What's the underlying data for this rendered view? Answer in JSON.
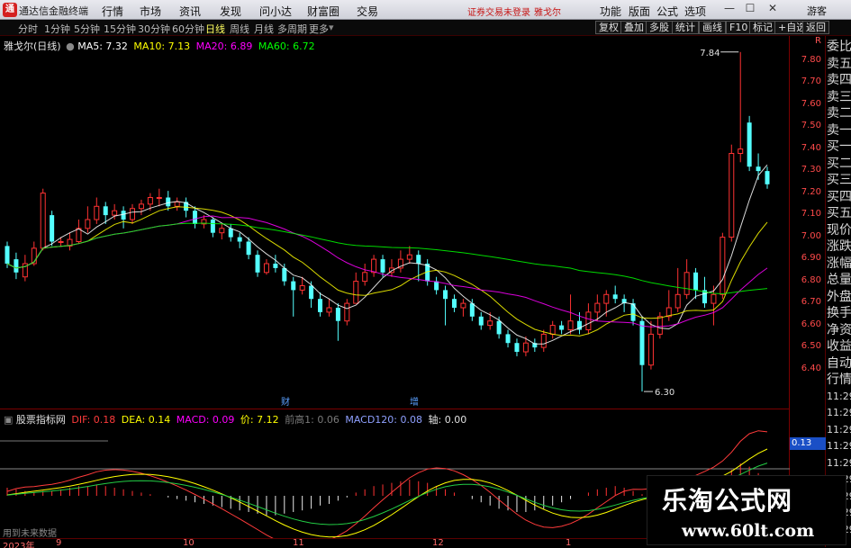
{
  "app": {
    "title": "通达信金融终端",
    "login_notice": "证券交易未登录",
    "stock_short": "雅戈尔",
    "guest": "游客"
  },
  "menus": [
    "行情",
    "市场",
    "资讯",
    "发现",
    "问小达",
    "财富圈",
    "交易"
  ],
  "right_menus": [
    "功能",
    "版面",
    "公式",
    "选项"
  ],
  "window_buttons": {
    "min": "—",
    "max": "☐",
    "close": "✕"
  },
  "periods": [
    "分时",
    "1分钟",
    "5分钟",
    "15分钟",
    "30分钟",
    "60分钟",
    "日线",
    "周线",
    "月线",
    "多周期",
    "更多"
  ],
  "active_period": "日线",
  "tools": [
    "复权",
    "叠加",
    "多股",
    "统计",
    "画线",
    "F10",
    "标记",
    "+自选",
    "返回"
  ],
  "main_info": {
    "stock": "雅戈尔(日线)",
    "ma5_label": "MA5: 7.32",
    "ma10_label": "MA10: 7.13",
    "ma20_label": "MA20: 6.89",
    "ma60_label": "MA60: 6.72",
    "colors": {
      "ma5": "#ffffff",
      "ma10": "#ffff00",
      "ma20": "#ff00ff",
      "ma60": "#00ff00"
    }
  },
  "annotations": {
    "high": "7.84",
    "low": "6.30",
    "event1": "财",
    "event2": "增"
  },
  "y_axis": [
    "7.80",
    "7.70",
    "7.60",
    "7.50",
    "7.40",
    "7.30",
    "7.20",
    "7.10",
    "7.00",
    "6.90",
    "6.80",
    "6.70",
    "6.60",
    "6.50",
    "6.40"
  ],
  "y_axis_top": "R",
  "right_side": [
    "委比",
    "卖五",
    "卖四",
    "卖三",
    "卖二",
    "卖一",
    "买一",
    "买二",
    "买三",
    "买四",
    "买五",
    "现价",
    "涨跌",
    "涨幅",
    "总量",
    "外盘",
    "换手",
    "净资",
    "收益",
    "自动",
    "行情",
    "11:29",
    "11:29",
    "11:29",
    "11:29",
    "11:29",
    "11:29",
    "11:29",
    "11:29",
    "11:29"
  ],
  "sub_info": {
    "name": "股票指标网",
    "dif": "DIF: 0.18",
    "dea": "DEA: 0.14",
    "macd": "MACD: 0.09",
    "price": "价: 7.12",
    "prev_high": "前高1: 0.06",
    "macd120": "MACD120: 0.08",
    "axis": "轴: 0.00"
  },
  "sub_value": "0.13",
  "x_axis": [
    "2023年",
    "9",
    "10",
    "11",
    "12",
    "1"
  ],
  "no_data": "用到未来数据",
  "watermark": {
    "title": "乐淘公式网",
    "url": "www.60lt.com"
  },
  "chart_data": {
    "type": "candlestick",
    "y_range": [
      6.28,
      7.88
    ],
    "candles": [
      [
        6.96,
        6.88,
        6.98,
        6.86
      ],
      [
        6.9,
        6.84,
        6.93,
        6.81
      ],
      [
        6.82,
        6.88,
        6.92,
        6.8
      ],
      [
        6.88,
        6.95,
        6.98,
        6.87
      ],
      [
        6.95,
        7.2,
        7.22,
        6.94
      ],
      [
        7.1,
        6.98,
        7.12,
        6.96
      ],
      [
        6.98,
        6.98,
        7.0,
        6.96
      ],
      [
        6.96,
        6.99,
        7.02,
        6.94
      ],
      [
        6.98,
        7.04,
        7.08,
        6.97
      ],
      [
        7.04,
        7.08,
        7.14,
        7.02
      ],
      [
        7.08,
        7.14,
        7.18,
        7.06
      ],
      [
        7.14,
        7.1,
        7.16,
        7.06
      ],
      [
        7.1,
        7.12,
        7.15,
        7.08
      ],
      [
        7.12,
        7.08,
        7.14,
        7.04
      ],
      [
        7.08,
        7.13,
        7.15,
        7.06
      ],
      [
        7.13,
        7.15,
        7.17,
        7.1
      ],
      [
        7.15,
        7.18,
        7.2,
        7.12
      ],
      [
        7.18,
        7.18,
        7.22,
        7.14
      ],
      [
        7.18,
        7.14,
        7.21,
        7.12
      ],
      [
        7.14,
        7.16,
        7.18,
        7.12
      ],
      [
        7.16,
        7.12,
        7.18,
        7.09
      ],
      [
        7.12,
        7.06,
        7.14,
        7.04
      ],
      [
        7.06,
        7.08,
        7.1,
        7.04
      ],
      [
        7.08,
        7.02,
        7.09,
        7.0
      ],
      [
        7.02,
        7.04,
        7.06,
        6.99
      ],
      [
        7.04,
        7.0,
        7.06,
        6.98
      ],
      [
        7.0,
        6.98,
        7.02,
        6.95
      ],
      [
        6.98,
        6.92,
        7.0,
        6.9
      ],
      [
        6.92,
        6.84,
        6.94,
        6.82
      ],
      [
        6.84,
        6.88,
        6.9,
        6.83
      ],
      [
        6.88,
        6.86,
        6.92,
        6.84
      ],
      [
        6.86,
        6.8,
        6.88,
        6.78
      ],
      [
        6.8,
        6.76,
        6.82,
        6.64
      ],
      [
        6.76,
        6.78,
        6.82,
        6.74
      ],
      [
        6.78,
        6.72,
        6.8,
        6.68
      ],
      [
        6.72,
        6.66,
        6.75,
        6.64
      ],
      [
        6.66,
        6.68,
        6.72,
        6.64
      ],
      [
        6.68,
        6.62,
        6.7,
        6.53
      ],
      [
        6.62,
        6.7,
        6.72,
        6.6
      ],
      [
        6.7,
        6.8,
        6.84,
        6.7
      ],
      [
        6.8,
        6.84,
        6.88,
        6.78
      ],
      [
        6.84,
        6.9,
        6.92,
        6.82
      ],
      [
        6.9,
        6.84,
        6.92,
        6.82
      ],
      [
        6.84,
        6.86,
        6.9,
        6.82
      ],
      [
        6.86,
        6.9,
        6.94,
        6.84
      ],
      [
        6.9,
        6.92,
        6.96,
        6.88
      ],
      [
        6.92,
        6.88,
        6.94,
        6.8
      ],
      [
        6.88,
        6.8,
        6.9,
        6.78
      ],
      [
        6.8,
        6.76,
        6.82,
        6.74
      ],
      [
        6.76,
        6.72,
        6.78,
        6.6
      ],
      [
        6.72,
        6.68,
        6.74,
        6.66
      ],
      [
        6.68,
        6.7,
        6.72,
        6.64
      ],
      [
        6.7,
        6.64,
        6.72,
        6.62
      ],
      [
        6.64,
        6.6,
        6.66,
        6.58
      ],
      [
        6.6,
        6.62,
        6.66,
        6.58
      ],
      [
        6.62,
        6.56,
        6.64,
        6.54
      ],
      [
        6.56,
        6.52,
        6.58,
        6.5
      ],
      [
        6.52,
        6.48,
        6.54,
        6.46
      ],
      [
        6.48,
        6.52,
        6.55,
        6.46
      ],
      [
        6.52,
        6.5,
        6.54,
        6.48
      ],
      [
        6.5,
        6.56,
        6.58,
        6.48
      ],
      [
        6.56,
        6.6,
        6.62,
        6.54
      ],
      [
        6.6,
        6.58,
        6.62,
        6.56
      ],
      [
        6.58,
        6.62,
        6.74,
        6.56
      ],
      [
        6.62,
        6.58,
        6.66,
        6.56
      ],
      [
        6.58,
        6.66,
        6.7,
        6.56
      ],
      [
        6.66,
        6.7,
        6.74,
        6.62
      ],
      [
        6.7,
        6.74,
        6.76,
        6.64
      ],
      [
        6.74,
        6.72,
        6.78,
        6.7
      ],
      [
        6.72,
        6.7,
        6.74,
        6.66
      ],
      [
        6.7,
        6.62,
        6.72,
        6.6
      ],
      [
        6.62,
        6.42,
        6.64,
        6.3
      ],
      [
        6.42,
        6.56,
        6.62,
        6.4
      ],
      [
        6.56,
        6.64,
        6.66,
        6.54
      ],
      [
        6.64,
        6.68,
        6.76,
        6.62
      ],
      [
        6.68,
        6.74,
        6.86,
        6.66
      ],
      [
        6.74,
        6.84,
        6.9,
        6.72
      ],
      [
        6.84,
        6.76,
        6.86,
        6.72
      ],
      [
        6.76,
        6.7,
        6.82,
        6.68
      ],
      [
        6.7,
        6.74,
        6.78,
        6.6
      ],
      [
        6.74,
        7.0,
        7.02,
        6.72
      ],
      [
        7.0,
        7.38,
        7.42,
        6.98
      ],
      [
        7.38,
        7.4,
        7.84,
        7.34
      ],
      [
        7.52,
        7.32,
        7.55,
        7.3
      ],
      [
        7.32,
        7.3,
        7.38,
        7.26
      ],
      [
        7.3,
        7.24,
        7.32,
        7.22
      ]
    ],
    "macd_hist": [
      0.05,
      0.04,
      0.03,
      0.02,
      0.03,
      0.03,
      0.04,
      0.05,
      0.06,
      0.06,
      0.07,
      0.06,
      0.05,
      0.04,
      0.03,
      0.02,
      0.01,
      0.0,
      -0.01,
      -0.02,
      -0.03,
      -0.04,
      -0.05,
      -0.06,
      -0.07,
      -0.08,
      -0.09,
      -0.1,
      -0.11,
      -0.12,
      -0.12,
      -0.11,
      -0.1,
      -0.09,
      -0.08,
      -0.06,
      -0.05,
      -0.03,
      -0.01,
      0.02,
      0.04,
      0.06,
      0.07,
      0.08,
      0.09,
      0.1,
      0.09,
      0.08,
      0.06,
      0.04,
      0.02,
      0.0,
      -0.02,
      -0.04,
      -0.06,
      -0.08,
      -0.09,
      -0.1,
      -0.1,
      -0.09,
      -0.08,
      -0.06,
      -0.04,
      -0.02,
      0.0,
      0.02,
      0.04,
      0.05,
      0.06,
      0.05,
      0.03,
      0.01,
      0.02,
      0.03,
      0.04,
      0.05,
      0.06,
      0.07,
      0.08,
      0.09,
      0.12,
      0.16,
      0.2,
      0.18,
      0.14,
      0.1
    ]
  }
}
